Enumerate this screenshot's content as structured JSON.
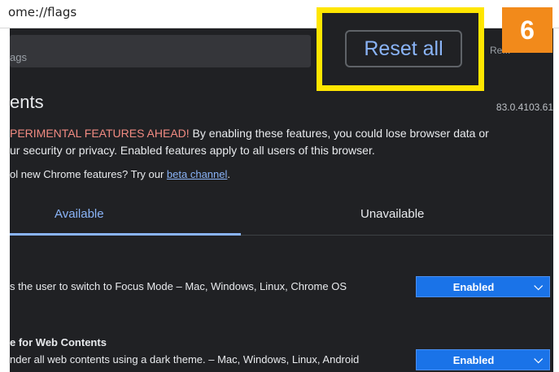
{
  "address_bar": {
    "url": "ome://flags"
  },
  "search": {
    "text": "ags"
  },
  "header": {
    "reset_small": "Re...",
    "title": "ents",
    "version": "83.0.4103.61"
  },
  "warning": {
    "red": "PERIMENTAL FEATURES AHEAD!",
    "text1": " By enabling these features, you could lose browser data or",
    "text2": "ur security or privacy. Enabled features apply to all users of this browser."
  },
  "beta": {
    "prefix": "ol new Chrome features? Try our ",
    "link": "beta channel",
    "suffix": "."
  },
  "tabs": {
    "available": "Available",
    "unavailable": "Unavailable"
  },
  "features": [
    {
      "desc": "s the user to switch to Focus Mode – Mac, Windows, Linux, Chrome OS",
      "value": "Enabled"
    },
    {
      "title": "e for Web Contents",
      "desc": "nder all web contents using a dark theme. – Mac, Windows, Linux, Android",
      "value": "Enabled"
    }
  ],
  "overlay": {
    "reset_all": "Reset all",
    "step": "6",
    "highlight_color": "#ffe600",
    "badge_color": "#f28a1b"
  }
}
